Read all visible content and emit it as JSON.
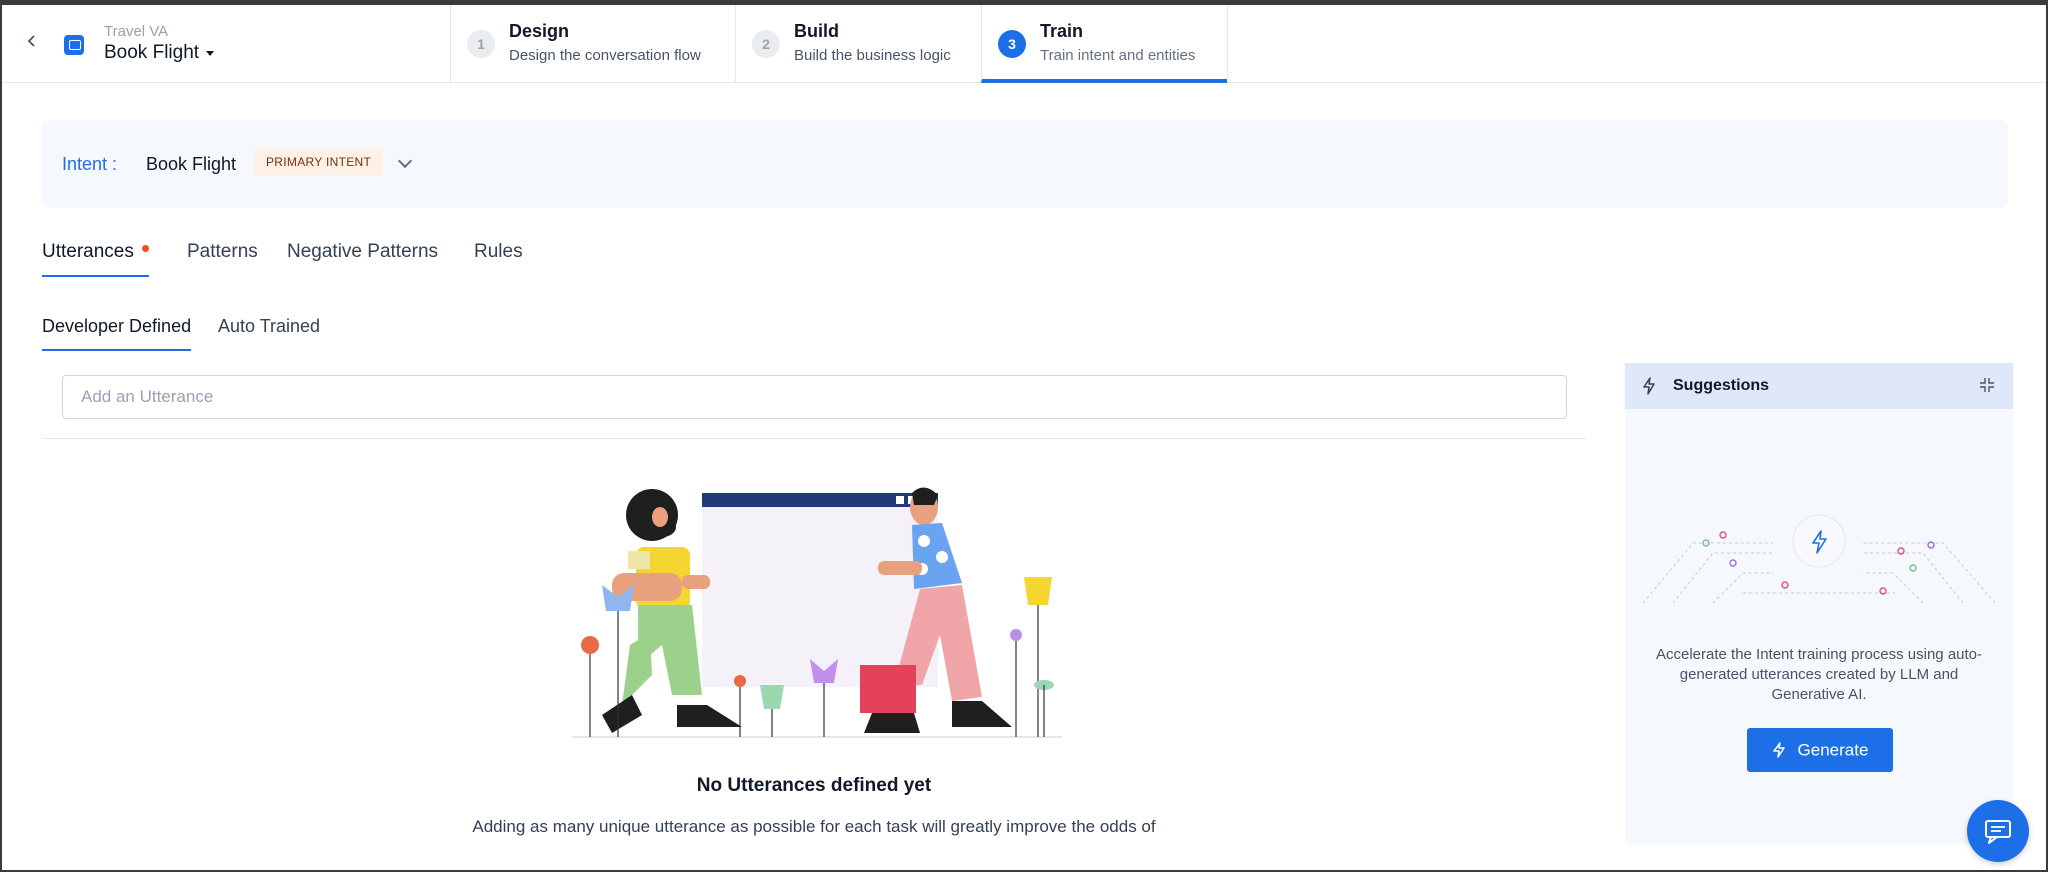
{
  "header": {
    "app_subtitle": "Travel VA",
    "app_title": "Book Flight",
    "steps": [
      {
        "number": "1",
        "title": "Design",
        "description": "Design the conversation flow"
      },
      {
        "number": "2",
        "title": "Build",
        "description": "Build the business logic"
      },
      {
        "number": "3",
        "title": "Train",
        "description": "Train intent and entities"
      }
    ],
    "active_step": "Train"
  },
  "intent": {
    "label": "Intent :",
    "name": "Book Flight",
    "badge": "PRIMARY INTENT"
  },
  "tabs": [
    {
      "label": "Utterances",
      "active": true,
      "has_indicator": true
    },
    {
      "label": "Patterns",
      "active": false
    },
    {
      "label": "Negative Patterns",
      "active": false
    },
    {
      "label": "Rules",
      "active": false
    }
  ],
  "subtabs": [
    {
      "label": "Developer Defined",
      "active": true
    },
    {
      "label": "Auto Trained",
      "active": false
    }
  ],
  "utterance_input": {
    "placeholder": "Add an Utterance",
    "value": ""
  },
  "empty_state": {
    "title": "No Utterances defined yet",
    "description": "Adding as many unique utterance as possible for each task will greatly improve the odds of"
  },
  "suggestions": {
    "title": "Suggestions",
    "description": "Accelerate the Intent training process using auto-generated utterances created by LLM and Generative AI.",
    "generate_label": "Generate"
  },
  "colors": {
    "accent": "#1d6fe8",
    "badge_bg": "#fdf0e6",
    "indicator_dot": "#f04e23",
    "panel_bg": "#f5f8fd"
  },
  "icons": {
    "back": "chevron-left-icon",
    "app": "bot-icon",
    "dropdown": "caret-down-icon",
    "intent_expand": "chevron-down-icon",
    "suggestions": "bolt-icon",
    "collapse": "collapse-icon",
    "chat": "chat-icon"
  }
}
